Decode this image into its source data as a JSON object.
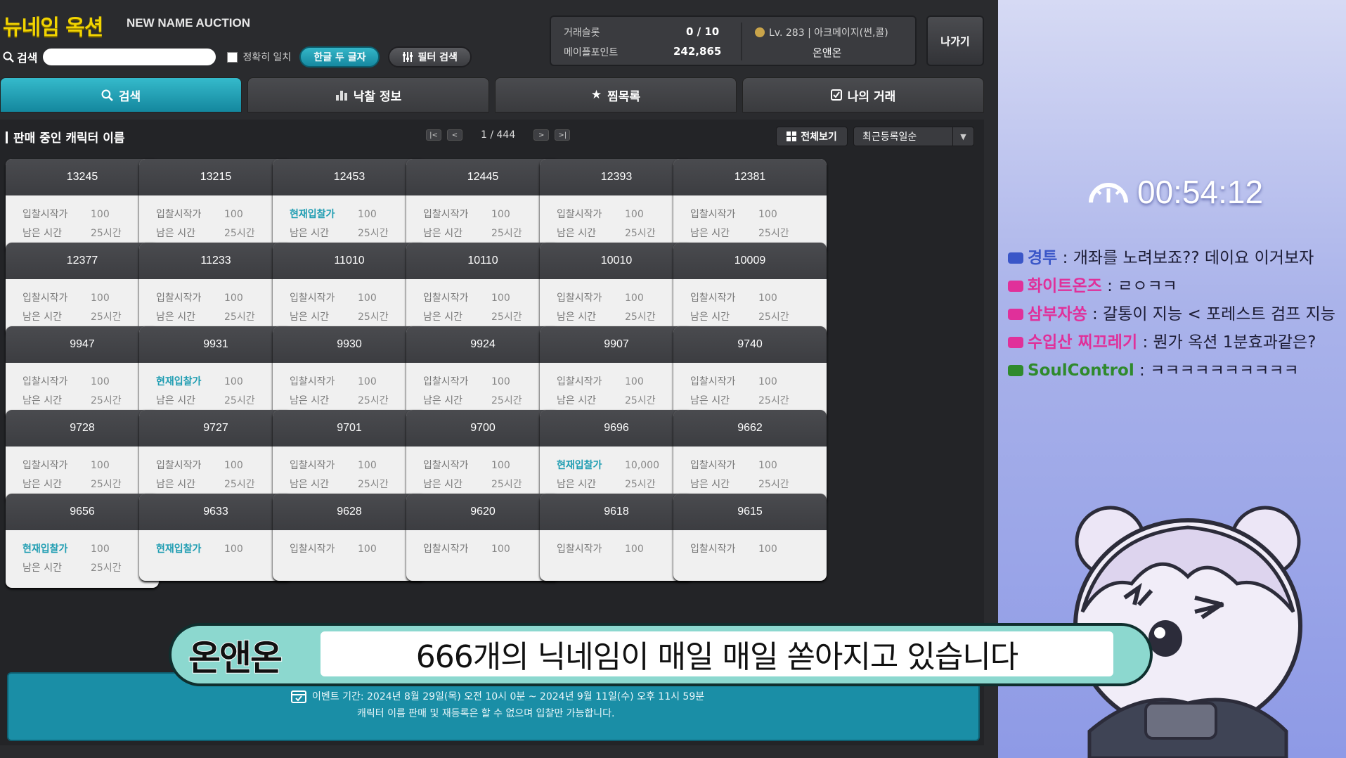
{
  "app": {
    "logo_ko": "뉴네임 옥션",
    "logo_en": "NEW NAME AUCTION"
  },
  "search": {
    "label": "검색",
    "value": "",
    "exact_match_label": "정확히 일치",
    "korean_two_char_label": "한글 두 글자",
    "filter_search_label": "필터 검색"
  },
  "status": {
    "trade_slot_label": "거래슬롯",
    "trade_slot_value": "0 / 10",
    "maple_point_label": "메이플포인트",
    "maple_point_value": "242,865",
    "character_info": "Lv. 283 | 아크메이지(썬,콜)",
    "character_name": "온앤온",
    "exit_label": "나가기"
  },
  "tabs": [
    {
      "label": "검색",
      "icon": "search-icon",
      "active": true
    },
    {
      "label": "낙찰 정보",
      "icon": "bar-chart-icon",
      "active": false
    },
    {
      "label": "찜목록",
      "icon": "star-icon",
      "active": false
    },
    {
      "label": "나의 거래",
      "icon": "checkbox-icon",
      "active": false
    }
  ],
  "list": {
    "title": "판매 중인 캐릭터 이름",
    "page": "1 / 444",
    "view_all_label": "전체보기",
    "sort_label": "최근등록일순"
  },
  "card_labels": {
    "start_bid": "입찰시작가",
    "current_bid": "현재입찰가",
    "remaining": "남은 시간"
  },
  "cards": [
    {
      "name": "13245",
      "bid_type": "start",
      "price": "100",
      "time": "25시간"
    },
    {
      "name": "13215",
      "bid_type": "start",
      "price": "100",
      "time": "25시간"
    },
    {
      "name": "12453",
      "bid_type": "current",
      "price": "100",
      "time": "25시간"
    },
    {
      "name": "12445",
      "bid_type": "start",
      "price": "100",
      "time": "25시간"
    },
    {
      "name": "12393",
      "bid_type": "start",
      "price": "100",
      "time": "25시간"
    },
    {
      "name": "12381",
      "bid_type": "start",
      "price": "100",
      "time": "25시간"
    },
    {
      "name": "12377",
      "bid_type": "start",
      "price": "100",
      "time": "25시간"
    },
    {
      "name": "11233",
      "bid_type": "start",
      "price": "100",
      "time": "25시간"
    },
    {
      "name": "11010",
      "bid_type": "start",
      "price": "100",
      "time": "25시간"
    },
    {
      "name": "10110",
      "bid_type": "start",
      "price": "100",
      "time": "25시간"
    },
    {
      "name": "10010",
      "bid_type": "start",
      "price": "100",
      "time": "25시간"
    },
    {
      "name": "10009",
      "bid_type": "start",
      "price": "100",
      "time": "25시간"
    },
    {
      "name": "9947",
      "bid_type": "start",
      "price": "100",
      "time": "25시간"
    },
    {
      "name": "9931",
      "bid_type": "current",
      "price": "100",
      "time": "25시간"
    },
    {
      "name": "9930",
      "bid_type": "start",
      "price": "100",
      "time": "25시간"
    },
    {
      "name": "9924",
      "bid_type": "start",
      "price": "100",
      "time": "25시간"
    },
    {
      "name": "9907",
      "bid_type": "start",
      "price": "100",
      "time": "25시간"
    },
    {
      "name": "9740",
      "bid_type": "start",
      "price": "100",
      "time": "25시간"
    },
    {
      "name": "9728",
      "bid_type": "start",
      "price": "100",
      "time": "25시간"
    },
    {
      "name": "9727",
      "bid_type": "start",
      "price": "100",
      "time": "25시간"
    },
    {
      "name": "9701",
      "bid_type": "start",
      "price": "100",
      "time": "25시간"
    },
    {
      "name": "9700",
      "bid_type": "start",
      "price": "100",
      "time": "25시간"
    },
    {
      "name": "9696",
      "bid_type": "current",
      "price": "10,000",
      "time": "25시간"
    },
    {
      "name": "9662",
      "bid_type": "start",
      "price": "100",
      "time": "25시간"
    },
    {
      "name": "9656",
      "bid_type": "current",
      "price": "100",
      "time": "25시간"
    },
    {
      "name": "9633",
      "bid_type": "current",
      "price": "100",
      "time": ""
    },
    {
      "name": "9628",
      "bid_type": "start",
      "price": "100",
      "time": ""
    },
    {
      "name": "9620",
      "bid_type": "start",
      "price": "100",
      "time": ""
    },
    {
      "name": "9618",
      "bid_type": "start",
      "price": "100",
      "time": ""
    },
    {
      "name": "9615",
      "bid_type": "start",
      "price": "100",
      "time": ""
    }
  ],
  "event": {
    "period": "이벤트 기간: 2024년 8월 29일(목) 오전 10시 0분  ~ 2024년 9월 11일(수) 오후 11시 59분",
    "notice": "캐릭터 이름 판매 및 재등록은 할 수 없으며 입찰만 가능합니다."
  },
  "overlay": {
    "timer": "00:54:12",
    "chat": [
      {
        "name": "경투",
        "text": "개좌를 노려보죠?? 데이요 이거보자",
        "color": "#3a56c8"
      },
      {
        "name": "화이트온즈",
        "text": "ㄹㅇㅋㅋ",
        "color": "#e0309a"
      },
      {
        "name": "삼부자쏭",
        "text": "갈통이 지능 < 포레스트 검프 지능",
        "color": "#e0309a"
      },
      {
        "name": "수입산 찌끄레기",
        "text": "뭔가 옥션 1분효과같은?",
        "color": "#e0309a"
      },
      {
        "name": "SoulControl",
        "text": "ㅋㅋㅋㅋㅋㅋㅋㅋㅋㅋ",
        "color": "#2f8a2c"
      }
    ],
    "subtitle_name": "온앤온",
    "subtitle_text": "666개의 닉네임이 매일 매일 쏟아지고 있습니다"
  },
  "colors": {
    "accent": "#1f9db2",
    "logo": "#f2d400"
  }
}
